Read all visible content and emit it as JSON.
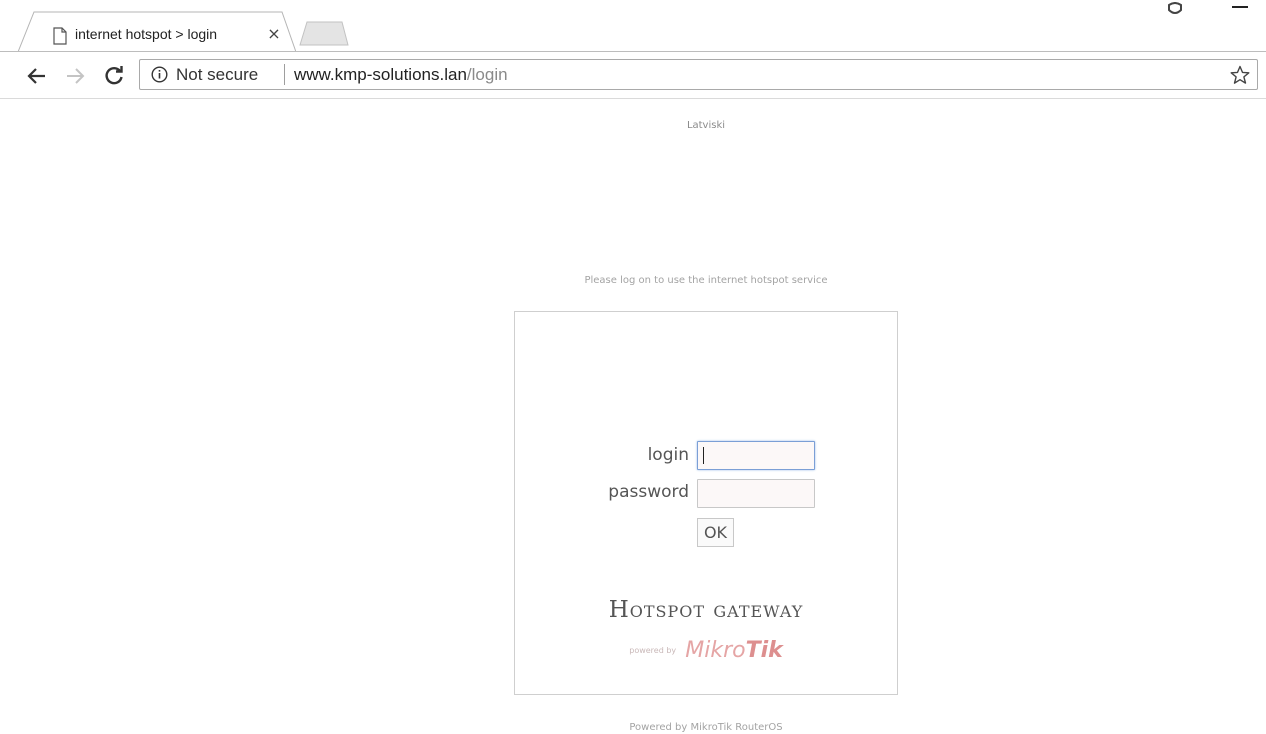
{
  "browser": {
    "tab": {
      "title": "internet hotspot > login",
      "close_glyph": "×"
    },
    "omnibox": {
      "security_label": "Not secure",
      "url_host": "www.kmp-solutions.lan",
      "url_path": "/login"
    },
    "icons": {
      "back": "arrow-left-icon",
      "forward": "arrow-right-icon",
      "reload": "reload-icon",
      "info": "info-icon",
      "star": "star-icon",
      "page": "page-icon"
    }
  },
  "page": {
    "language_link": "Latviski",
    "notice": "Please log on to use the internet hotspot service",
    "form": {
      "login_label": "login",
      "password_label": "password",
      "login_value": "",
      "password_value": "",
      "submit_label": "OK"
    },
    "branding": {
      "title": "Hotspot gateway",
      "powered_by": "powered by",
      "logo_text_light": "Mikro",
      "logo_text_bold": "Tik"
    },
    "footer": "Powered by MikroTik RouterOS"
  },
  "colors": {
    "input_focus_border": "#7b9fd6",
    "logo": "#e5a5a5"
  }
}
